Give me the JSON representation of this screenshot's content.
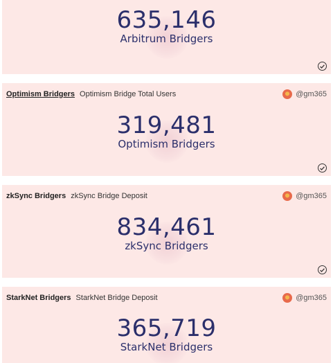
{
  "cards": [
    {
      "query_title": "",
      "viz_title": "",
      "author": "",
      "value": "635,146",
      "label": "Arbitrum Bridgers",
      "status_icon": "check-circle-icon"
    },
    {
      "query_title": "Optimism Bridgers",
      "viz_title": "Optimism Bridge Total Users",
      "author": "@gm365",
      "value": "319,481",
      "label": "Optimism Bridgers",
      "status_icon": "check-circle-icon"
    },
    {
      "query_title": "zkSync Bridgers",
      "viz_title": "zkSync Bridge Deposit",
      "author": "@gm365",
      "value": "834,461",
      "label": "zkSync Bridgers",
      "status_icon": "check-circle-icon"
    },
    {
      "query_title": "StarkNet Bridgers",
      "viz_title": "StarkNet Bridge Deposit",
      "author": "@gm365",
      "value": "365,719",
      "label": "StarkNet Bridgers"
    }
  ],
  "colors": {
    "card_background": "#fde8e6",
    "counter_text": "#2b2f6b"
  }
}
